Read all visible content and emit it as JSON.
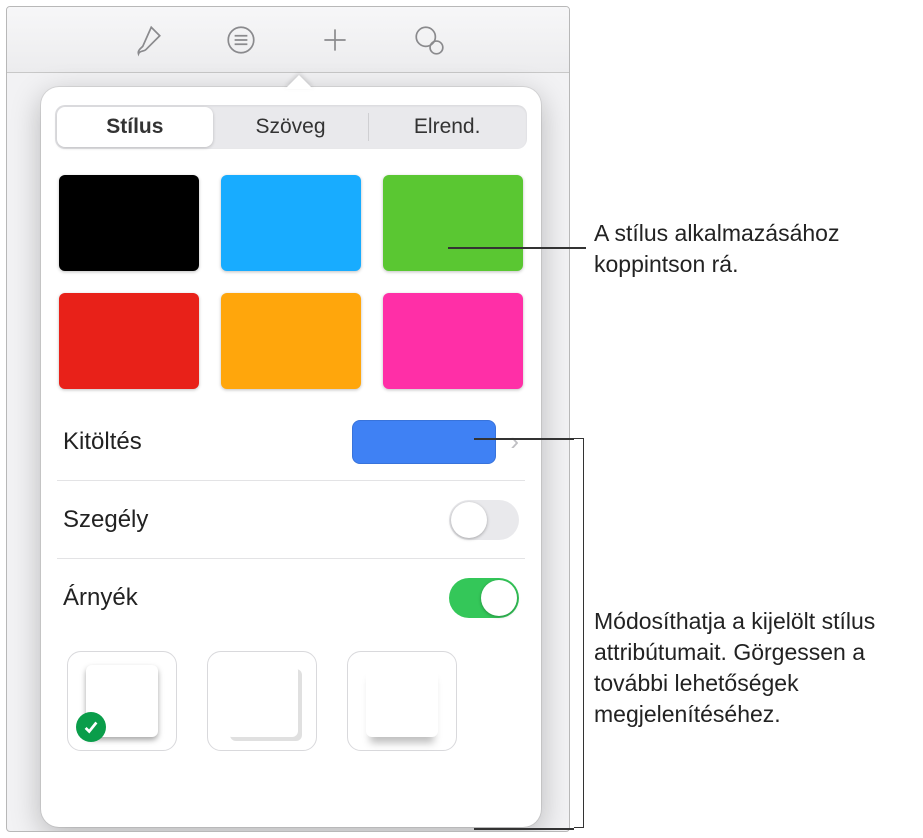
{
  "toolbar": {
    "icons": [
      "paintbrush-icon",
      "list-icon",
      "plus-icon",
      "collaborate-icon"
    ]
  },
  "tabs": {
    "style": "Stílus",
    "text": "Szöveg",
    "arrange": "Elrend."
  },
  "swatches": [
    {
      "name": "black",
      "color": "#000000"
    },
    {
      "name": "blue",
      "color": "#18acff"
    },
    {
      "name": "green",
      "color": "#5ac732"
    },
    {
      "name": "red",
      "color": "#e82119"
    },
    {
      "name": "orange",
      "color": "#ffa60c"
    },
    {
      "name": "magenta",
      "color": "#ff2fa7"
    }
  ],
  "rows": {
    "fill_label": "Kitöltés",
    "fill_color": "#3f81f4",
    "border_label": "Szegély",
    "border_on": false,
    "shadow_label": "Árnyék",
    "shadow_on": true
  },
  "callouts": {
    "swatch": "A stílus alkalmazásához koppintson rá.",
    "attrs": "Módosíthatja a kijelölt stílus attribútumait. Görgessen a további lehetőségek megjelenítéséhez."
  }
}
